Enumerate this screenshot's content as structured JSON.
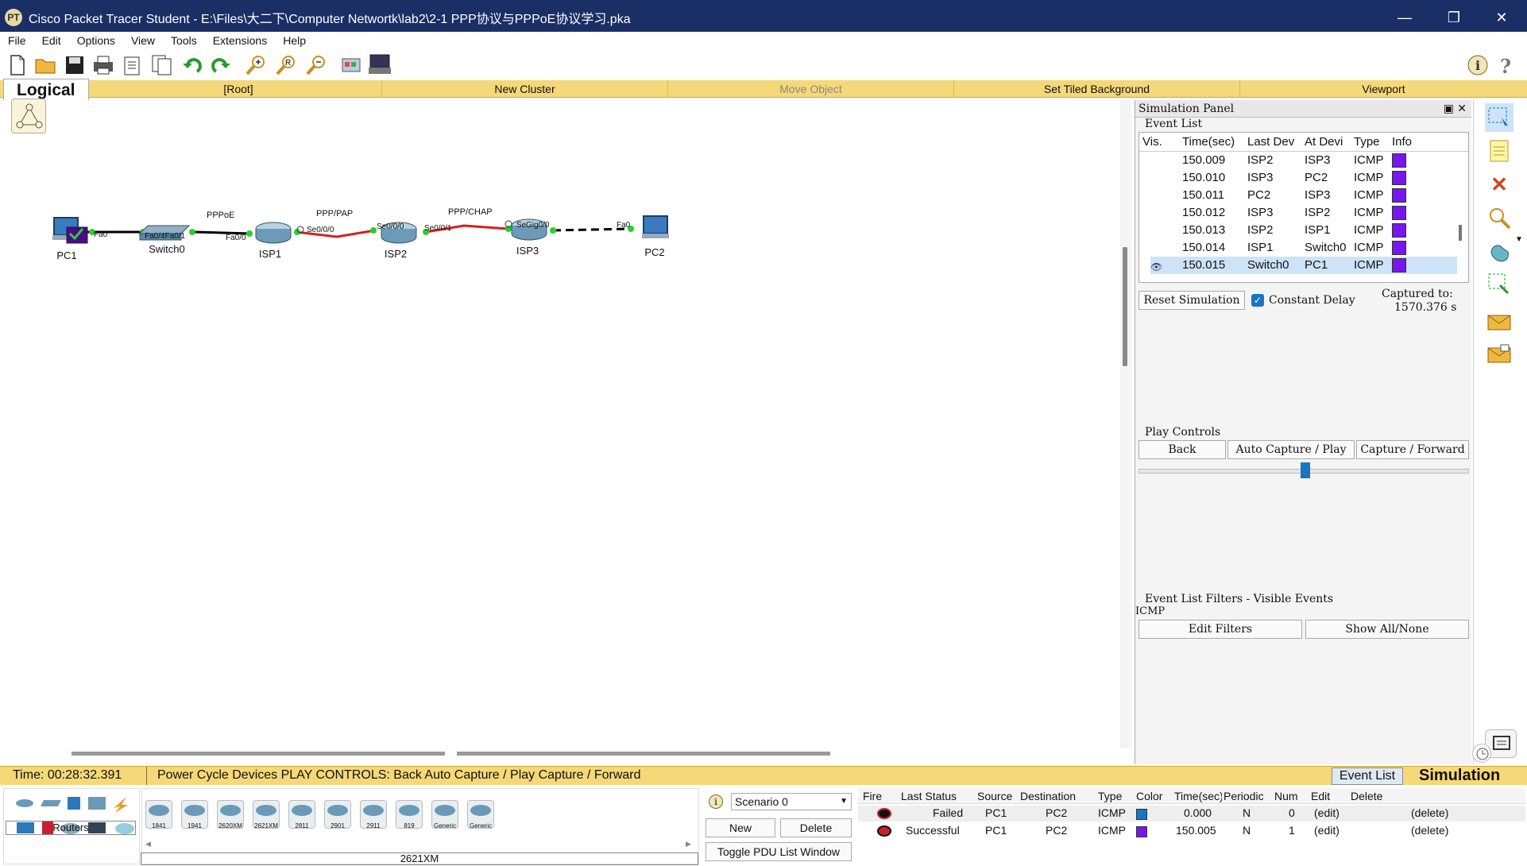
{
  "window": {
    "title": "Cisco Packet Tracer Student - E:\\Files\\大二下\\Computer Networtk\\lab2\\2-1 PPP协议与PPPoE协议学习.pka",
    "logo": "PT",
    "controls": {
      "minimize": "—",
      "maximize": "❐",
      "close": "✕"
    }
  },
  "menu": [
    "File",
    "Edit",
    "Options",
    "View",
    "Tools",
    "Extensions",
    "Help"
  ],
  "toolbar": {
    "icons": [
      "new-icon",
      "open-icon",
      "save-icon",
      "print-icon",
      "activity-wizard-icon",
      "copy-icon",
      "undo-icon",
      "redo-icon",
      "zoom-in-icon",
      "zoom-reset-icon",
      "zoom-out-icon",
      "palette-icon",
      "device-template-icon",
      "info-icon",
      "help-icon"
    ]
  },
  "logical_bar": {
    "tab": "Logical",
    "root": "[Root]",
    "new_cluster": "New Cluster",
    "move_object": "Move Object",
    "set_tiled_background": "Set Tiled Background",
    "viewport": "Viewport"
  },
  "topology": {
    "devices": [
      {
        "name": "PC1",
        "type": "pc"
      },
      {
        "name": "Switch0",
        "type": "switch"
      },
      {
        "name": "ISP1",
        "type": "router"
      },
      {
        "name": "ISP2",
        "type": "router"
      },
      {
        "name": "ISP3",
        "type": "router"
      },
      {
        "name": "PC2",
        "type": "pc"
      }
    ],
    "link_labels": [
      "PPPoE",
      "PPP/PAP",
      "PPP/CHAP"
    ],
    "port_labels": [
      "Fa0",
      "Fa0/4Fa0/1",
      "Fa0/0",
      "Se0/0/0",
      "Se0/0/0",
      "Se0/0/1",
      "Se",
      "Gig0/0",
      "Fa0"
    ]
  },
  "sim_panel": {
    "title": "Simulation Panel",
    "event_list_title": "Event List",
    "headers": [
      "Vis.",
      "Time(sec)",
      "Last Dev",
      "At Devi",
      "Type",
      "Info"
    ],
    "rows": [
      {
        "time": "150.009",
        "last": "ISP2",
        "at": "ISP3",
        "type": "ICMP",
        "color": "#7716ee"
      },
      {
        "time": "150.010",
        "last": "ISP3",
        "at": "PC2",
        "type": "ICMP",
        "color": "#7716ee"
      },
      {
        "time": "150.011",
        "last": "PC2",
        "at": "ISP3",
        "type": "ICMP",
        "color": "#7716ee"
      },
      {
        "time": "150.012",
        "last": "ISP3",
        "at": "ISP2",
        "type": "ICMP",
        "color": "#7716ee"
      },
      {
        "time": "150.013",
        "last": "ISP2",
        "at": "ISP1",
        "type": "ICMP",
        "color": "#7716ee"
      },
      {
        "time": "150.014",
        "last": "ISP1",
        "at": "Switch0",
        "type": "ICMP",
        "color": "#7716ee"
      },
      {
        "time": "150.015",
        "last": "Switch0",
        "at": "PC1",
        "type": "ICMP",
        "color": "#7716ee"
      }
    ],
    "reset_simulation": "Reset Simulation",
    "constant_delay": "Constant Delay",
    "captured_to_label": "Captured to:",
    "captured_to_value": "1570.376 s",
    "play_controls_title": "Play Controls",
    "back": "Back",
    "auto_capture": "Auto Capture / Play",
    "capture_forward": "Capture / Forward",
    "filters_title": "Event List Filters - Visible Events",
    "filters_value": "ICMP",
    "edit_filters": "Edit Filters",
    "show_all_none": "Show All/None"
  },
  "status_bar": {
    "time": "Time: 00:28:32.391",
    "message": "Power Cycle Devices PLAY CONTROLS:  Back   Auto Capture / Play  Capture / Forward",
    "event_list": "Event List",
    "mode": "Simulation"
  },
  "device_panel": {
    "category": "Routers",
    "models": [
      "1841",
      "1941",
      "2620XM",
      "2621XM",
      "2811",
      "2901",
      "2911",
      "819",
      "Generic",
      "Generic"
    ],
    "selected_model": "2621XM"
  },
  "scenario": {
    "selected": "Scenario 0",
    "new": "New",
    "delete": "Delete",
    "toggle": "Toggle PDU List Window"
  },
  "pdu_list": {
    "headers": [
      "Fire",
      "Last Status",
      "Source",
      "Destination",
      "Type",
      "Color",
      "Time(sec)",
      "Periodic",
      "Num",
      "Edit",
      "Delete"
    ],
    "rows": [
      {
        "status": "Failed",
        "source": "PC1",
        "dest": "PC2",
        "type": "ICMP",
        "color": "#1a74c4",
        "time": "0.000",
        "periodic": "N",
        "num": "0",
        "edit": "(edit)",
        "delete": "(delete)"
      },
      {
        "status": "Successful",
        "source": "PC1",
        "dest": "PC2",
        "type": "ICMP",
        "color": "#7716ee",
        "time": "150.005",
        "periodic": "N",
        "num": "1",
        "edit": "(edit)",
        "delete": "(delete)"
      }
    ]
  }
}
